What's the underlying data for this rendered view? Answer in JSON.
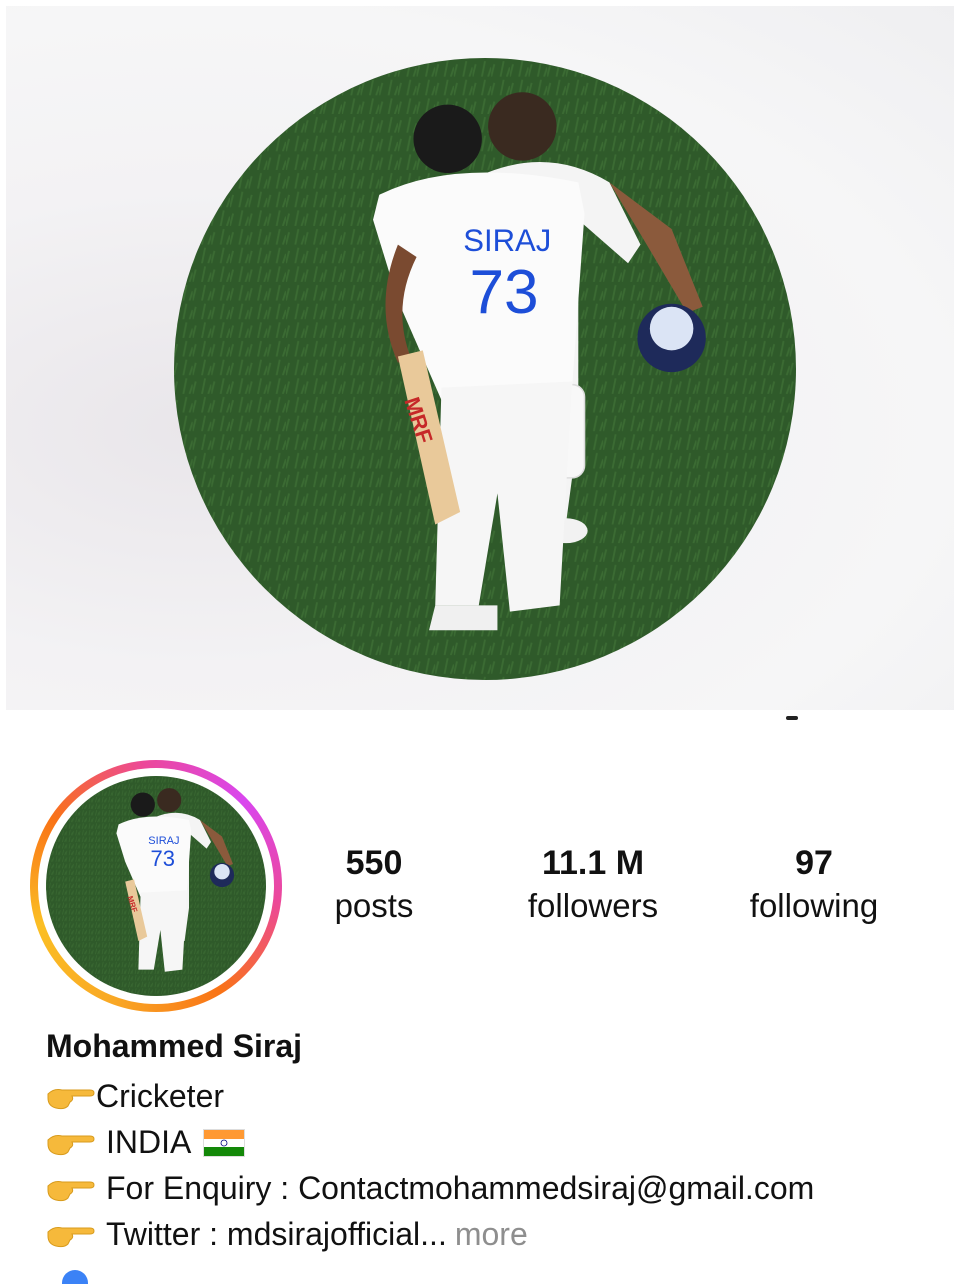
{
  "profile": {
    "name": "Mohammed Siraj",
    "photo_alt": "profile-photo"
  },
  "stats": [
    {
      "value": "550",
      "label": "posts"
    },
    {
      "value": "11.1 M",
      "label": "followers"
    },
    {
      "value": "97",
      "label": "following"
    }
  ],
  "bio": {
    "line1": "Cricketer",
    "line2": "INDIA",
    "line3": "For Enquiry : Contactmohammedsiraj@gmail.com",
    "line4": "Twitter : mdsirajofficial...",
    "more_label": "more"
  },
  "jersey": {
    "name": "SIRAJ",
    "number": "73",
    "bat_brand": "MRF"
  },
  "colors": {
    "grass": "#2f5a2a",
    "ring_start": "#f9a825",
    "ring_end": "#d946ef",
    "more": "#8e8e8e"
  },
  "icons": {
    "bullet": "pointing-hand-icon",
    "flag": "india-flag-icon"
  }
}
